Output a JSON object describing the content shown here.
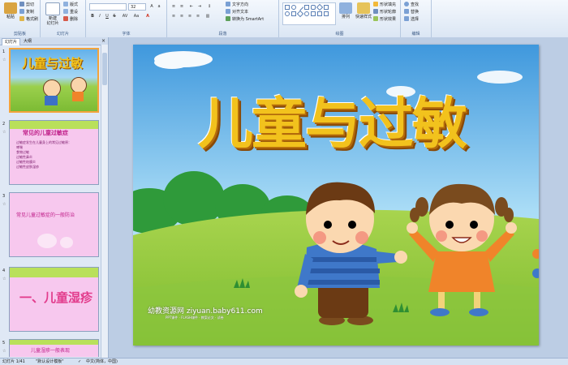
{
  "ribbon": {
    "clipboard": {
      "paste": "粘贴",
      "cut": "剪切",
      "copy": "复制",
      "format_painter": "格式刷",
      "label": "剪贴板"
    },
    "slides": {
      "new_slide": "新建\n幻灯片",
      "layout": "版式",
      "reset": "重设",
      "delete": "删除",
      "label": "幻灯片"
    },
    "font": {
      "name_value": "",
      "size_value": "32",
      "label": "字体"
    },
    "paragraph": {
      "text_direction": "文字方向",
      "align_text": "对齐文本",
      "smartart": "转换为 SmartArt",
      "label": "段落"
    },
    "drawing": {
      "arrange": "排列",
      "quick_styles": "快速样式",
      "shape_fill": "形状填充",
      "shape_outline": "形状轮廓",
      "shape_effects": "形状效果",
      "label": "绘图"
    },
    "editing": {
      "find": "查找",
      "replace": "替换",
      "select": "选择",
      "label": "编辑"
    }
  },
  "panel": {
    "tabs": [
      "幻灯片",
      "大纲"
    ],
    "close": "×",
    "slides": [
      {
        "num": "1",
        "anim": "☆",
        "title": "儿童与过敏"
      },
      {
        "num": "2",
        "anim": "☆",
        "heading": "常见的儿童过敏症",
        "lines": [
          "过敏症发生在儿童身上的常见过敏原：",
          "哮喘",
          "食物过敏",
          "过敏性鼻炎",
          "过敏性结膜炎",
          "过敏性皮肤湿疹"
        ]
      },
      {
        "num": "3",
        "anim": "☆",
        "heading": "常见儿童过敏症的一般防治"
      },
      {
        "num": "4",
        "anim": "☆",
        "heading": "一、儿童湿疹"
      },
      {
        "num": "5",
        "anim": "☆",
        "heading": "儿童湿疹一般表现"
      }
    ]
  },
  "slide": {
    "title": "儿童与过敏",
    "watermark": "幼教资源网 ziyuan.baby611.com",
    "watermark_sub": "PPT课件 · FLASH课件 · 教案论文 · 试卷"
  },
  "status": {
    "slide_info": "幻灯片 1/41",
    "theme": "\"默认设计模板\"",
    "language": "中文(简体，中国)"
  },
  "colors": {
    "sky": "#5aa7e3",
    "grass": "#8cc63f",
    "title_gold": "#f2c21d",
    "thumb_pink": "#f7c8ee",
    "thumb_green": "#b9e05a"
  }
}
